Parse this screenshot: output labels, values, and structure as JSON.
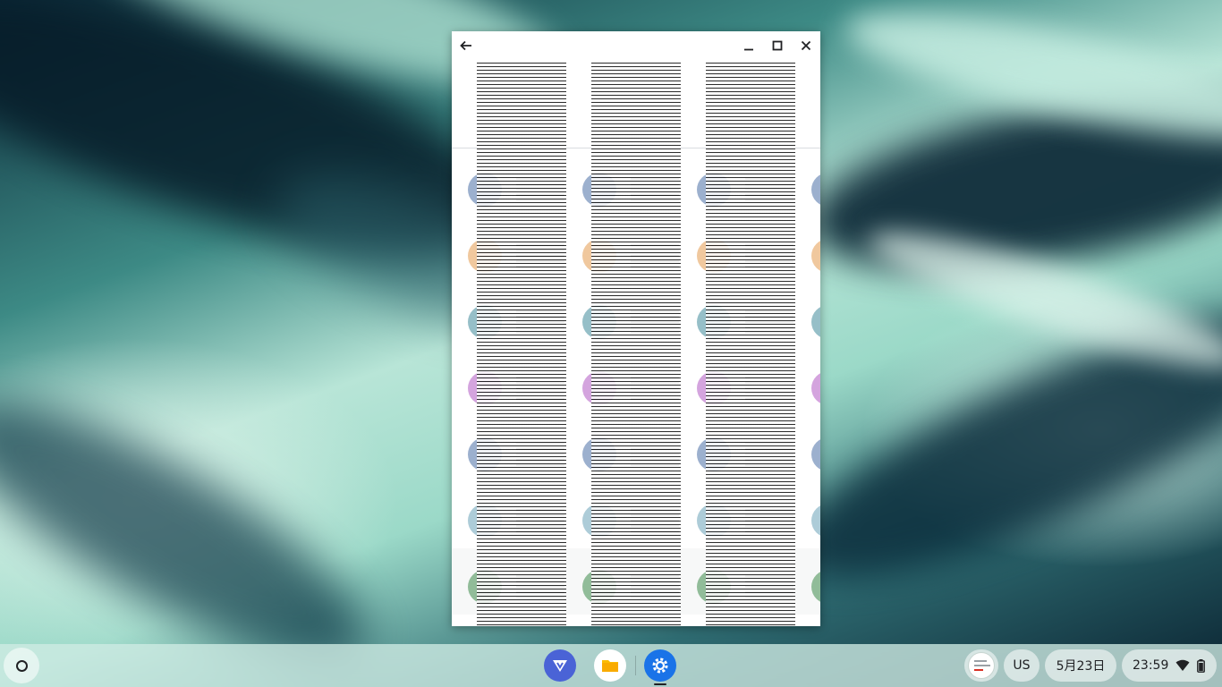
{
  "window": {
    "back_icon": "arrow-left-icon",
    "minimize_icon": "minimize-icon",
    "maximize_icon": "maximize-icon",
    "close_icon": "close-icon"
  },
  "content": {
    "avatar_colors": [
      "#4a6fa5",
      "#e39a4f",
      "#3f8a9a",
      "#b05ac2",
      "#4a6fa5",
      "#6aa3b8",
      "#3e8a4a",
      "#c25a7a"
    ]
  },
  "shelf": {
    "launcher_icon": "launcher-circle-icon",
    "apps": [
      {
        "name": "vpn-app-icon",
        "color": "#4a63d6"
      },
      {
        "name": "files-app-icon",
        "color": "#fbbc04"
      },
      {
        "name": "settings-app-icon",
        "color": "#1a73e8"
      }
    ],
    "ime": "US",
    "date": "5月23日",
    "time": "23:59",
    "wifi_icon": "wifi-icon",
    "battery_icon": "battery-icon"
  }
}
